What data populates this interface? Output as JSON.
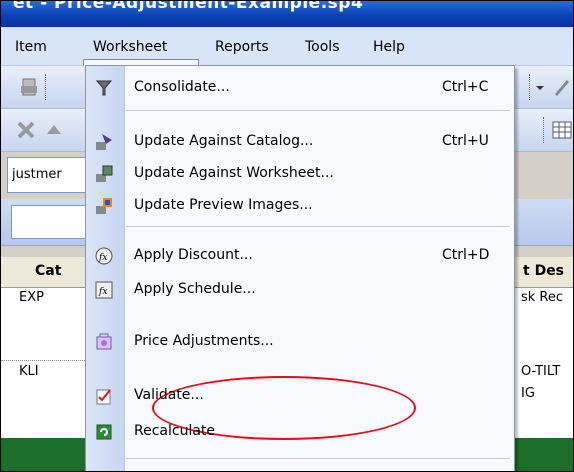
{
  "window": {
    "title": "et - Price-Adjustment-Example.sp4"
  },
  "menubar": {
    "items": [
      {
        "label": "Item"
      },
      {
        "label": "Worksheet"
      },
      {
        "label": "Reports"
      },
      {
        "label": "Tools"
      },
      {
        "label": "Help"
      }
    ]
  },
  "toolbar": {
    "combo_value": "justmer"
  },
  "grid": {
    "headers": {
      "cat": "Cat",
      "desc": "t Des"
    },
    "rows": [
      {
        "cat": "EXP",
        "desc": "sk Rec"
      },
      {
        "cat": "KLI",
        "desc": "O-TILT",
        "desc2": "IG"
      }
    ]
  },
  "worksheet_menu": {
    "items": [
      {
        "label": "Consolidate...",
        "shortcut": "Ctrl+C",
        "icon": "consolidate-icon"
      },
      {
        "label": "Update Against Catalog...",
        "shortcut": "Ctrl+U",
        "icon": "update-catalog-icon"
      },
      {
        "label": "Update Against Worksheet...",
        "shortcut": "",
        "icon": "update-worksheet-icon"
      },
      {
        "label": "Update Preview Images...",
        "shortcut": "",
        "icon": "preview-images-icon"
      },
      {
        "label": "Apply Discount...",
        "shortcut": "Ctrl+D",
        "icon": "discount-fx-icon"
      },
      {
        "label": "Apply Schedule...",
        "shortcut": "",
        "icon": "schedule-fx-icon"
      },
      {
        "label": "Price Adjustments...",
        "shortcut": "",
        "icon": "price-adjustment-icon"
      },
      {
        "label": "Validate...",
        "shortcut": "",
        "icon": "validate-icon"
      },
      {
        "label": "Recalculate",
        "shortcut": "",
        "icon": "recalculate-icon"
      }
    ]
  },
  "colors": {
    "highlight_ellipse": "#e0101a",
    "title_bar": "#0a3fb0",
    "status_bar": "#1d6e2a"
  }
}
